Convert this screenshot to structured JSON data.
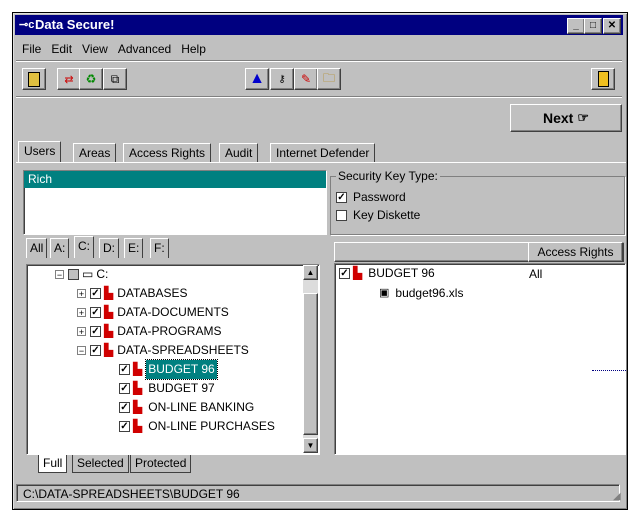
{
  "window": {
    "title": "Data Secure!"
  },
  "menu": [
    "File",
    "Edit",
    "View",
    "Advanced",
    "Help"
  ],
  "next_button": "Next",
  "tabs": [
    "Users",
    "Areas",
    "Access Rights",
    "Audit",
    "Internet Defender"
  ],
  "users": {
    "selected": "Rich"
  },
  "security": {
    "legend": "Security Key Type:",
    "password": "Password",
    "diskette": "Key Diskette"
  },
  "drive_tabs": [
    "All",
    "A:",
    "C:",
    "D:",
    "E:",
    "F:"
  ],
  "tree": {
    "root": "C:",
    "items": [
      "DATABASES",
      "DATA-DOCUMENTS",
      "DATA-PROGRAMS",
      "DATA-SPREADSHEETS"
    ],
    "children": [
      "BUDGET 96",
      "BUDGET 97",
      "ON-LINE BANKING",
      "ON-LINE PURCHASES"
    ]
  },
  "rights": {
    "header": "Access Rights",
    "folder": "BUDGET 96",
    "value": "All",
    "file": "budget96.xls"
  },
  "bottom_tabs": [
    "Full",
    "Selected",
    "Protected"
  ],
  "status": "C:\\DATA-SPREADSHEETS\\BUDGET 96"
}
